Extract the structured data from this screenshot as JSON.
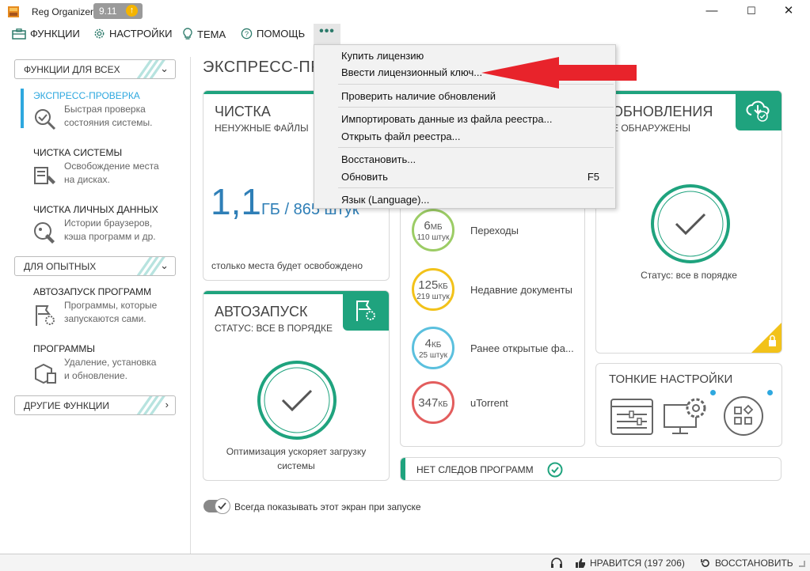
{
  "window": {
    "title": "Reg Organizer",
    "version": "9.11",
    "minimize": "—",
    "maximize": "☐",
    "close": "✕"
  },
  "menu": {
    "functions": "ФУНКЦИИ",
    "settings": "НАСТРОЙКИ",
    "theme": "ТЕМА",
    "help": "ПОМОЩЬ",
    "more": "•••"
  },
  "dropdown": {
    "buy": "Купить лицензию",
    "enter_key": "Ввести лицензионный ключ...",
    "check_updates": "Проверить наличие обновлений",
    "import": "Импортировать данные из файла реестра...",
    "open_reg": "Открыть файл реестра...",
    "restore": "Восстановить...",
    "refresh": "Обновить",
    "refresh_shortcut": "F5",
    "language": "Язык (Language)..."
  },
  "sidebar": {
    "group1": "ФУНКЦИИ ДЛЯ ВСЕХ",
    "express": {
      "title": "ЭКСПРЕСС-ПРОВЕРКА",
      "desc1": "Быстрая проверка",
      "desc2": "состояния системы."
    },
    "clean_sys": {
      "title": "ЧИСТКА СИСТЕМЫ",
      "desc1": "Освобождение места",
      "desc2": "на дисках."
    },
    "clean_personal": {
      "title": "ЧИСТКА ЛИЧНЫХ ДАННЫХ",
      "desc1": "Истории браузеров,",
      "desc2": "кэша программ и др."
    },
    "group2": "ДЛЯ ОПЫТНЫХ",
    "autorun": {
      "title": "АВТОЗАПУСК ПРОГРАММ",
      "desc1": "Программы, которые",
      "desc2": "запускаются сами."
    },
    "programs": {
      "title": "ПРОГРАММЫ",
      "desc1": "Удаление, установка",
      "desc2": "и обновление."
    },
    "group3": "ДРУГИЕ ФУНКЦИИ"
  },
  "main": {
    "title": "ЭКСПРЕСС-ПР"
  },
  "clean_card": {
    "title": "ЧИСТКА",
    "subtitle": "НЕНУЖНЫЕ ФАЙЛЫ",
    "value": "1,1",
    "unit": "ГБ / 865 штук",
    "note": "столько места будет освобождено"
  },
  "autorun_card": {
    "title": "АВТОЗАПУСК",
    "subtitle": "СТАТУС: ВСЕ В ПОРЯДКЕ",
    "note1": "Оптимизация ускоряет загрузку",
    "note2": "системы"
  },
  "traces": [
    {
      "size": "6",
      "unit": "МБ",
      "count": "110 штук",
      "label": "Переходы",
      "color": "#9ccc65"
    },
    {
      "size": "125",
      "unit": "КБ",
      "count": "219 штук",
      "label": "Недавние документы",
      "color": "#f2c21a"
    },
    {
      "size": "4",
      "unit": "КБ",
      "count": "25 штук",
      "label": "Ранее открытые фа...",
      "color": "#5bc0de"
    },
    {
      "size": "347",
      "unit": "КБ",
      "count": "",
      "label": "uTorrent",
      "color": "#e35d5d"
    }
  ],
  "updates_card": {
    "title": "ОБНОВЛЕНИЯ",
    "subtitle": "Е ОБНАРУЖЕНЫ",
    "status": "Статус: все в порядке"
  },
  "tweaks_card": {
    "title": "ТОНКИЕ НАСТРОЙКИ"
  },
  "no_traces": {
    "label": "НЕТ СЛЕДОВ ПРОГРАММ"
  },
  "toggle": {
    "label": "Всегда показывать этот экран при запуске",
    "on": true
  },
  "statusbar": {
    "like": "НРАВИТСЯ (197 206)",
    "restore": "ВОССТАНОВИТЬ"
  },
  "colors": {
    "accent_green": "#1fa37e",
    "accent_blue": "#2ea8df",
    "arrow_red": "#e8232b"
  }
}
